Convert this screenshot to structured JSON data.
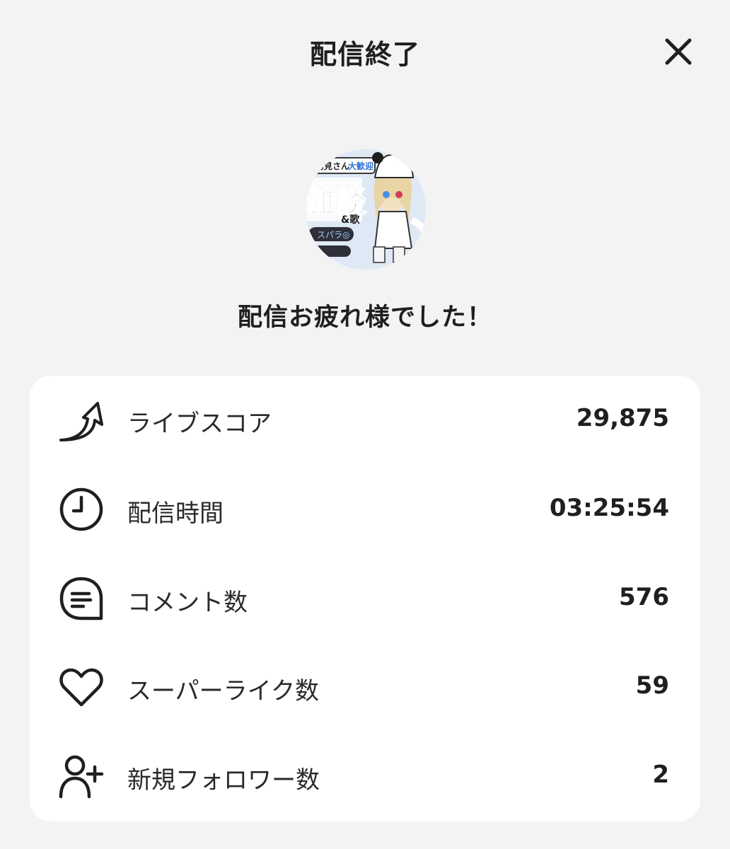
{
  "header": {
    "title": "配信終了"
  },
  "close_icon": "close-icon",
  "avatar": {
    "texts": [
      "初見さん",
      "大歓迎",
      "雑談",
      "&歌",
      "スパラ◎"
    ]
  },
  "message": "配信お疲れ様でした！",
  "stats": [
    {
      "icon": "live-score-arrow-icon",
      "label": "ライブスコア",
      "value": "29,875"
    },
    {
      "icon": "clock-icon",
      "label": "配信時間",
      "value": "03:25:54"
    },
    {
      "icon": "comment-icon",
      "label": "コメント数",
      "value": "576"
    },
    {
      "icon": "heart-icon",
      "label": "スーパーライク数",
      "value": "59"
    },
    {
      "icon": "add-user-icon",
      "label": "新規フォロワー数",
      "value": "2"
    }
  ]
}
